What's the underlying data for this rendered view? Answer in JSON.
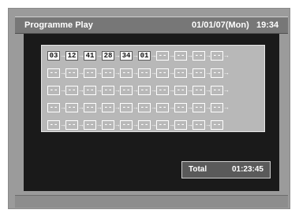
{
  "header": {
    "title": "Programme Play",
    "date": "01/01/07(Mon)",
    "time": "19:34"
  },
  "playlist": {
    "rows": [
      [
        "03",
        "12",
        "41",
        "28",
        "34",
        "01",
        "--",
        "--",
        "--",
        "--"
      ],
      [
        "--",
        "--",
        "--",
        "--",
        "--",
        "--",
        "--",
        "--",
        "--",
        "--"
      ],
      [
        "--",
        "--",
        "--",
        "--",
        "--",
        "--",
        "--",
        "--",
        "--",
        "--"
      ],
      [
        "--",
        "--",
        "--",
        "--",
        "--",
        "--",
        "--",
        "--",
        "--",
        "--"
      ],
      [
        "--",
        "--",
        "--",
        "--",
        "--",
        "--",
        "--",
        "--",
        "--",
        "--"
      ]
    ],
    "arrow_glyph": "→"
  },
  "total": {
    "label": "Total",
    "value": "01:23:45"
  },
  "colors": {
    "title_bar": "#777777",
    "frame": "#9b9b9b",
    "inner_background": "#1a1a1a",
    "grid_panel": "#b8b8b8"
  }
}
